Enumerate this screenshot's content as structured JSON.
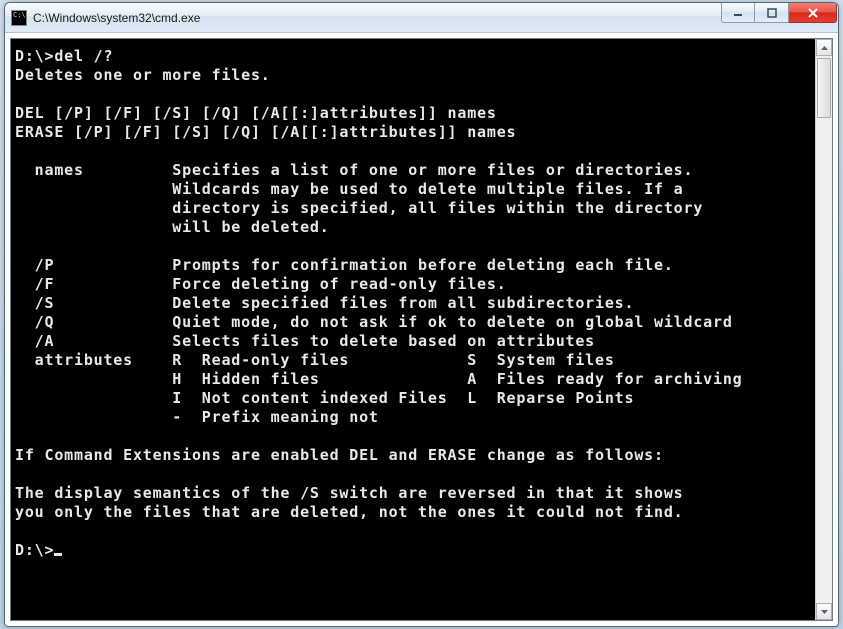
{
  "window": {
    "title": "C:\\Windows\\system32\\cmd.exe"
  },
  "console": {
    "prompt1": "D:\\>del /?",
    "desc": "Deletes one or more files.",
    "syntax1": "DEL [/P] [/F] [/S] [/Q] [/A[[:]attributes]] names",
    "syntax2": "ERASE [/P] [/F] [/S] [/Q] [/A[[:]attributes]] names",
    "names_l1": "  names         Specifies a list of one or more files or directories.",
    "names_l2": "                Wildcards may be used to delete multiple files. If a",
    "names_l3": "                directory is specified, all files within the directory",
    "names_l4": "                will be deleted.",
    "p": "  /P            Prompts for confirmation before deleting each file.",
    "f": "  /F            Force deleting of read-only files.",
    "s": "  /S            Delete specified files from all subdirectories.",
    "q": "  /Q            Quiet mode, do not ask if ok to delete on global wildcard",
    "a": "  /A            Selects files to delete based on attributes",
    "attr1": "  attributes    R  Read-only files            S  System files",
    "attr2": "                H  Hidden files               A  Files ready for archiving",
    "attr3": "                I  Not content indexed Files  L  Reparse Points",
    "attr4": "                -  Prefix meaning not",
    "ext": "If Command Extensions are enabled DEL and ERASE change as follows:",
    "sem1": "The display semantics of the /S switch are reversed in that it shows",
    "sem2": "you only the files that are deleted, not the ones it could not find.",
    "prompt2": "D:\\>"
  }
}
